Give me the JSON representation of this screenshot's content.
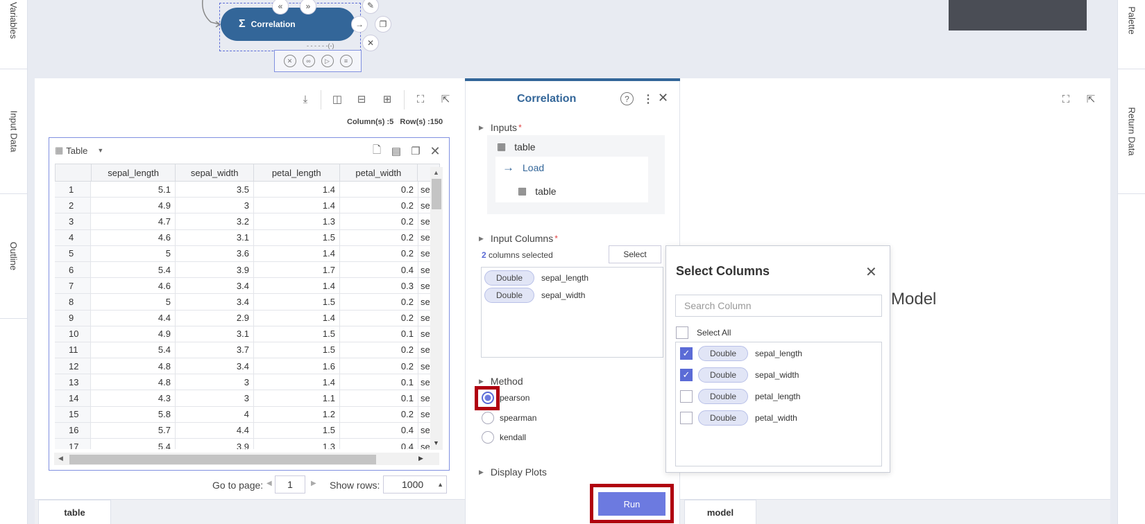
{
  "left_rail": {
    "tabs": [
      "Variables",
      "Input Data",
      "Outline"
    ]
  },
  "right_rail": {
    "tabs": [
      "Palette",
      "Return Data"
    ]
  },
  "flow": {
    "node_label": "Correlation",
    "node_icon": "sigma-icon",
    "node_footer": "- - - - - -(-)"
  },
  "data_view": {
    "summary": "Column(s) :5   Row(s) :150",
    "table_selector": "Table",
    "columns": [
      "sepal_length",
      "sepal_width",
      "petal_length",
      "petal_width"
    ],
    "rows": [
      [
        "1",
        "5.1",
        "3.5",
        "1.4",
        "0.2",
        "se"
      ],
      [
        "2",
        "4.9",
        "3",
        "1.4",
        "0.2",
        "se"
      ],
      [
        "3",
        "4.7",
        "3.2",
        "1.3",
        "0.2",
        "se"
      ],
      [
        "4",
        "4.6",
        "3.1",
        "1.5",
        "0.2",
        "se"
      ],
      [
        "5",
        "5",
        "3.6",
        "1.4",
        "0.2",
        "se"
      ],
      [
        "6",
        "5.4",
        "3.9",
        "1.7",
        "0.4",
        "se"
      ],
      [
        "7",
        "4.6",
        "3.4",
        "1.4",
        "0.3",
        "se"
      ],
      [
        "8",
        "5",
        "3.4",
        "1.5",
        "0.2",
        "se"
      ],
      [
        "9",
        "4.4",
        "2.9",
        "1.4",
        "0.2",
        "se"
      ],
      [
        "10",
        "4.9",
        "3.1",
        "1.5",
        "0.1",
        "se"
      ],
      [
        "11",
        "5.4",
        "3.7",
        "1.5",
        "0.2",
        "se"
      ],
      [
        "12",
        "4.8",
        "3.4",
        "1.6",
        "0.2",
        "se"
      ],
      [
        "13",
        "4.8",
        "3",
        "1.4",
        "0.1",
        "se"
      ],
      [
        "14",
        "4.3",
        "3",
        "1.1",
        "0.1",
        "se"
      ],
      [
        "15",
        "5.8",
        "4",
        "1.2",
        "0.2",
        "se"
      ],
      [
        "16",
        "5.7",
        "4.4",
        "1.5",
        "0.4",
        "se"
      ],
      [
        "17",
        "5.4",
        "3.9",
        "1.3",
        "0.4",
        "se"
      ]
    ],
    "pager": {
      "go_to_label": "Go to page:",
      "page": "1",
      "show_rows_label": "Show rows:",
      "rows_value": "1000"
    },
    "bottom_tab": "table"
  },
  "props": {
    "title": "Correlation",
    "inputs_label": "Inputs",
    "inputs_item": "table",
    "load_label": "Load",
    "load_item": "table",
    "input_columns_label": "Input Columns",
    "selected_count": "2",
    "selected_text": "columns selected",
    "select_button": "Select",
    "selected_columns": [
      {
        "type": "Double",
        "name": "sepal_length"
      },
      {
        "type": "Double",
        "name": "sepal_width"
      }
    ],
    "method_label": "Method",
    "methods": [
      "pearson",
      "spearman",
      "kendall"
    ],
    "method_selected": "pearson",
    "display_plots_label": "Display Plots",
    "run_label": "Run"
  },
  "dialog": {
    "title": "Select Columns",
    "search_placeholder": "Search Column",
    "select_all": "Select All",
    "columns": [
      {
        "type": "Double",
        "name": "sepal_length",
        "checked": true
      },
      {
        "type": "Double",
        "name": "sepal_width",
        "checked": true
      },
      {
        "type": "Double",
        "name": "petal_length",
        "checked": false
      },
      {
        "type": "Double",
        "name": "petal_width",
        "checked": false
      }
    ]
  },
  "model_view": {
    "title": "Model",
    "bottom_tab": "model"
  },
  "colors": {
    "accent": "#5b6bd6",
    "node": "#336699",
    "highlight": "#b00010"
  }
}
